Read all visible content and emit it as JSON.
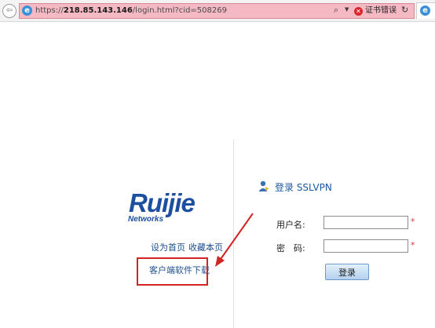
{
  "browser": {
    "url_prefix": "https://",
    "url_host": "218.85.143.146",
    "url_path": "/login.html?cid=508269",
    "cert_error": "证书错误",
    "address_bar_color": "#f4b9c3"
  },
  "brand": {
    "logo_text": "Ruijie",
    "logo_subtext": "Networks",
    "logo_color": "#1d4fa0"
  },
  "left_links": {
    "set_home": "设为首页",
    "bookmark": "收藏本页",
    "client_download": "客户端软件下载"
  },
  "login": {
    "title": "登录 SSLVPN",
    "username_label": "用户名:",
    "username_value": "",
    "password_label": "密　码:",
    "password_value": "",
    "required_mark": "*",
    "submit_label": "登录"
  },
  "annotation": {
    "highlight_color": "#d32424"
  }
}
